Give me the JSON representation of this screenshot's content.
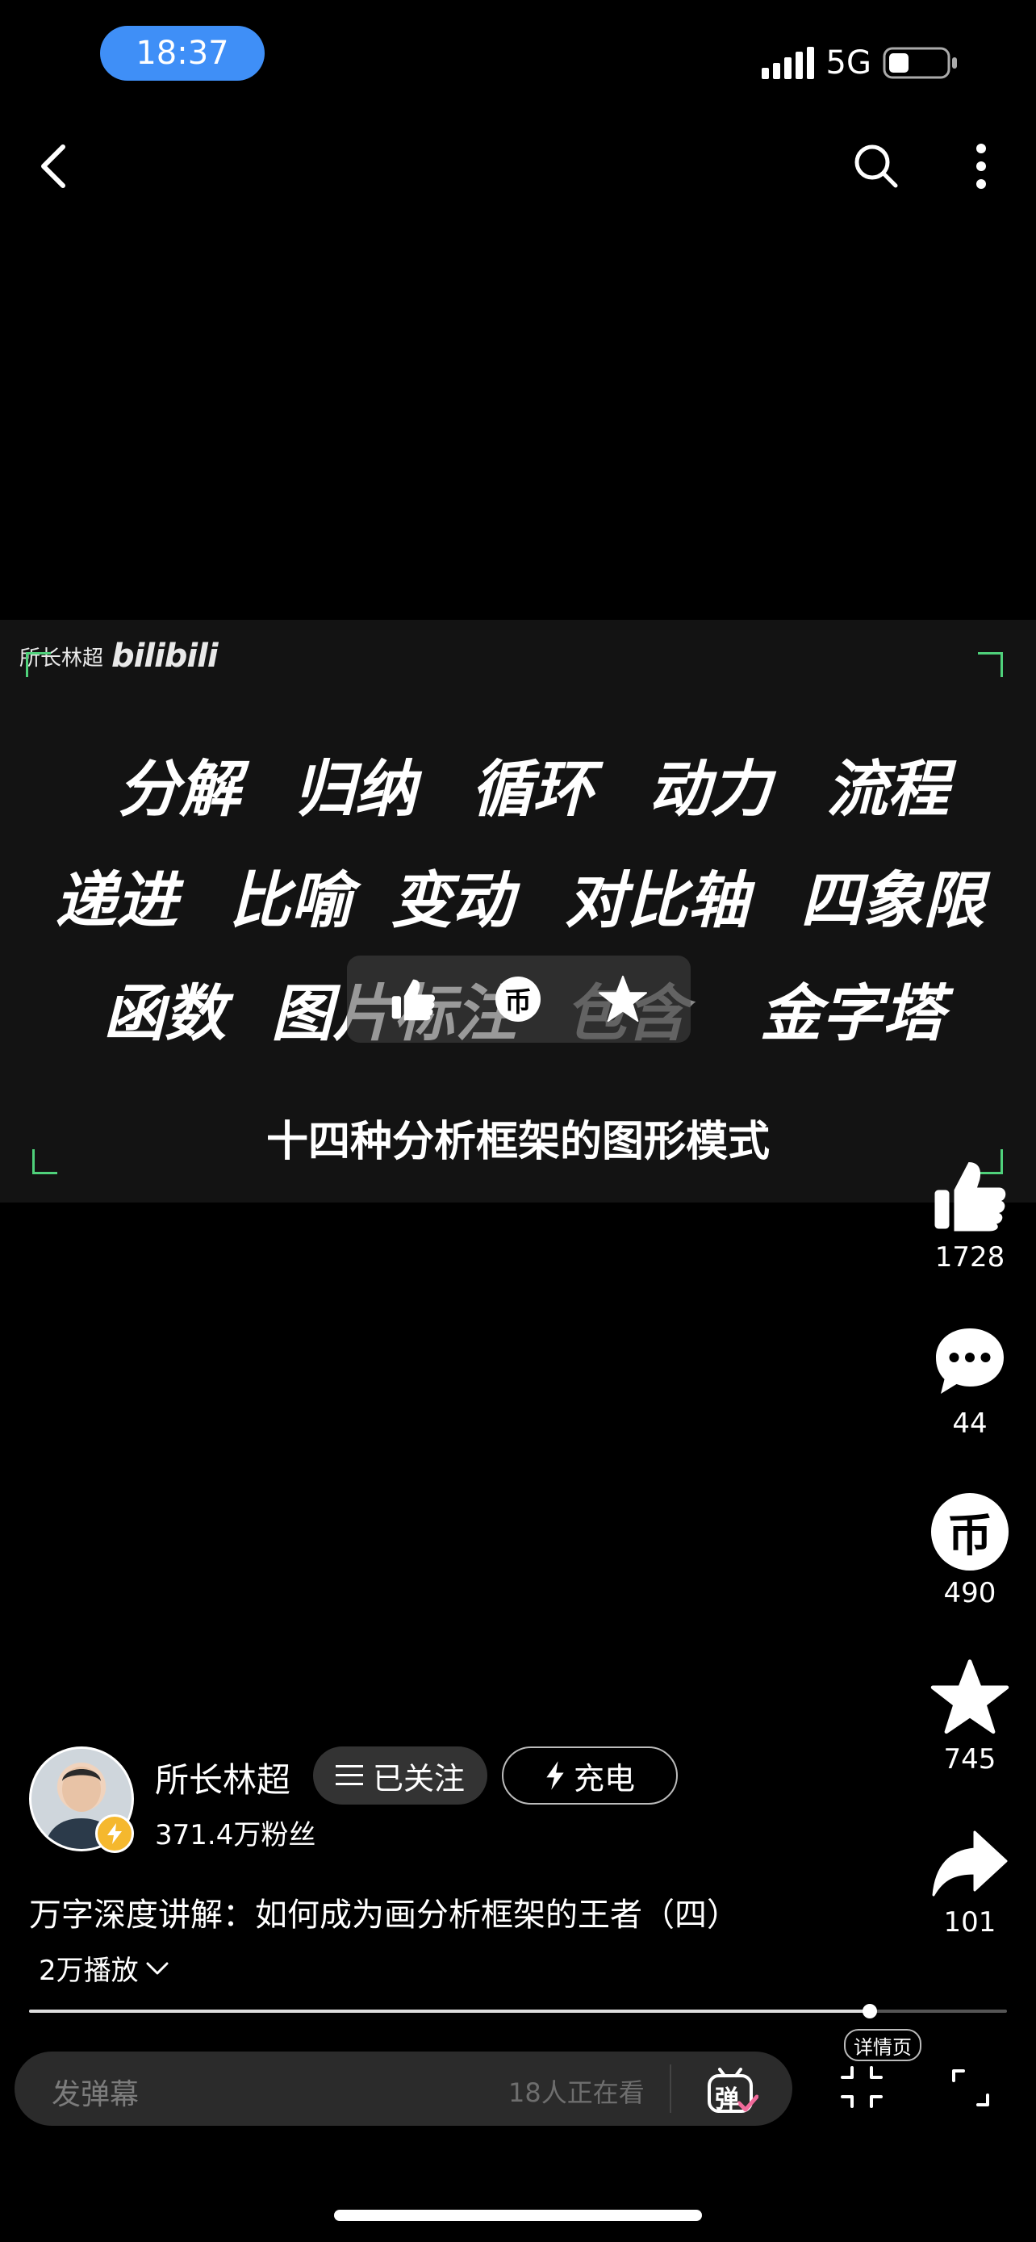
{
  "status_bar": {
    "time": "18:37",
    "network": "5G",
    "battery_level": 0.35
  },
  "top_bar": {
    "back_icon": "chevron-left-icon",
    "search_icon": "search-icon",
    "more_icon": "more-vertical-icon"
  },
  "video": {
    "watermark_name": "所长林超",
    "watermark_logo": "bilibili",
    "rows": [
      [
        "分解",
        "归纳",
        "循环",
        "动力",
        "流程"
      ],
      [
        "递进",
        "比喻",
        "变动",
        "对比轴",
        "四象限"
      ],
      [
        "函数",
        "图片标注",
        "包含",
        "金字塔"
      ]
    ],
    "subtitle": "十四种分析框架的图形模式",
    "overlay_icons": [
      "thumb-up-icon",
      "coin-icon",
      "star-icon"
    ],
    "overlay_coin_char": "币",
    "accent_color": "#4fd17b"
  },
  "actions": {
    "like": {
      "icon": "thumb-up-icon",
      "count": "1728"
    },
    "comment": {
      "icon": "comment-icon",
      "count": "44"
    },
    "coin": {
      "icon": "coin-icon",
      "glyph": "币",
      "count": "490"
    },
    "favorite": {
      "icon": "star-icon",
      "count": "745"
    },
    "share": {
      "icon": "share-icon",
      "count": "101"
    }
  },
  "uploader": {
    "name": "所长林超",
    "fans": "371.4万粉丝",
    "follow_label": "已关注",
    "charge_label": "充电"
  },
  "video_info": {
    "title": "万字深度讲解：如何成为画分析框架的王者（四）",
    "plays": "2万播放"
  },
  "progress": {
    "played_fraction": 0.86
  },
  "bottom_bar": {
    "danmaku_placeholder": "发弹幕",
    "watching": "18人正在看",
    "danmaku_toggle_char": "弹",
    "detail_label": "详情页"
  }
}
